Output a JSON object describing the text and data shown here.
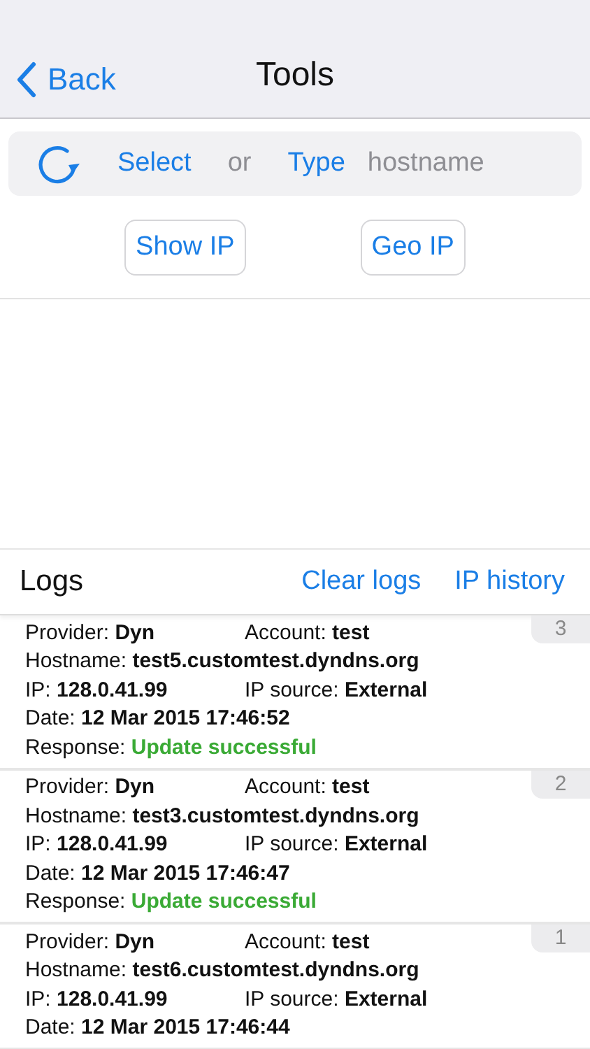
{
  "nav": {
    "back": "Back",
    "title": "Tools"
  },
  "search": {
    "select": "Select",
    "or": "or",
    "type": "Type",
    "placeholder": "hostname"
  },
  "buttons": [
    "Show IP",
    "Geo IP"
  ],
  "logs": {
    "title": "Logs",
    "actions": [
      "Clear logs",
      "IP history"
    ],
    "entries": [
      {
        "number": "3",
        "lines": [
          [
            {
              "label": "Provider:",
              "value": "Dyn"
            },
            {
              "label": "Account:",
              "value": "test"
            }
          ],
          [
            {
              "label": "Hostname:",
              "value": "test5.customtest.dyndns.org"
            }
          ],
          [
            {
              "label": "IP:",
              "value": "128.0.41.99"
            },
            {
              "label": "IP source:",
              "value": "External"
            }
          ],
          [
            {
              "label": "Date:",
              "value": "12 Mar 2015 17:46:52"
            }
          ],
          [
            {
              "label": "Response:",
              "value": "Update successful",
              "kind": "success"
            }
          ]
        ]
      },
      {
        "number": "2",
        "lines": [
          [
            {
              "label": "Provider:",
              "value": "Dyn"
            },
            {
              "label": "Account:",
              "value": "test"
            }
          ],
          [
            {
              "label": "Hostname:",
              "value": "test3.customtest.dyndns.org"
            }
          ],
          [
            {
              "label": "IP:",
              "value": "128.0.41.99"
            },
            {
              "label": "IP source:",
              "value": "External"
            }
          ],
          [
            {
              "label": "Date:",
              "value": "12 Mar 2015 17:46:47"
            }
          ],
          [
            {
              "label": "Response:",
              "value": "Update successful",
              "kind": "success"
            }
          ]
        ]
      },
      {
        "number": "1",
        "lines": [
          [
            {
              "label": "Provider:",
              "value": "Dyn"
            },
            {
              "label": "Account:",
              "value": "test"
            }
          ],
          [
            {
              "label": "Hostname:",
              "value": "test6.customtest.dyndns.org"
            }
          ],
          [
            {
              "label": "IP:",
              "value": "128.0.41.99"
            },
            {
              "label": "IP source:",
              "value": "External"
            }
          ],
          [
            {
              "label": "Date:",
              "value": "12 Mar 2015 17:46:44"
            }
          ]
        ]
      }
    ]
  }
}
